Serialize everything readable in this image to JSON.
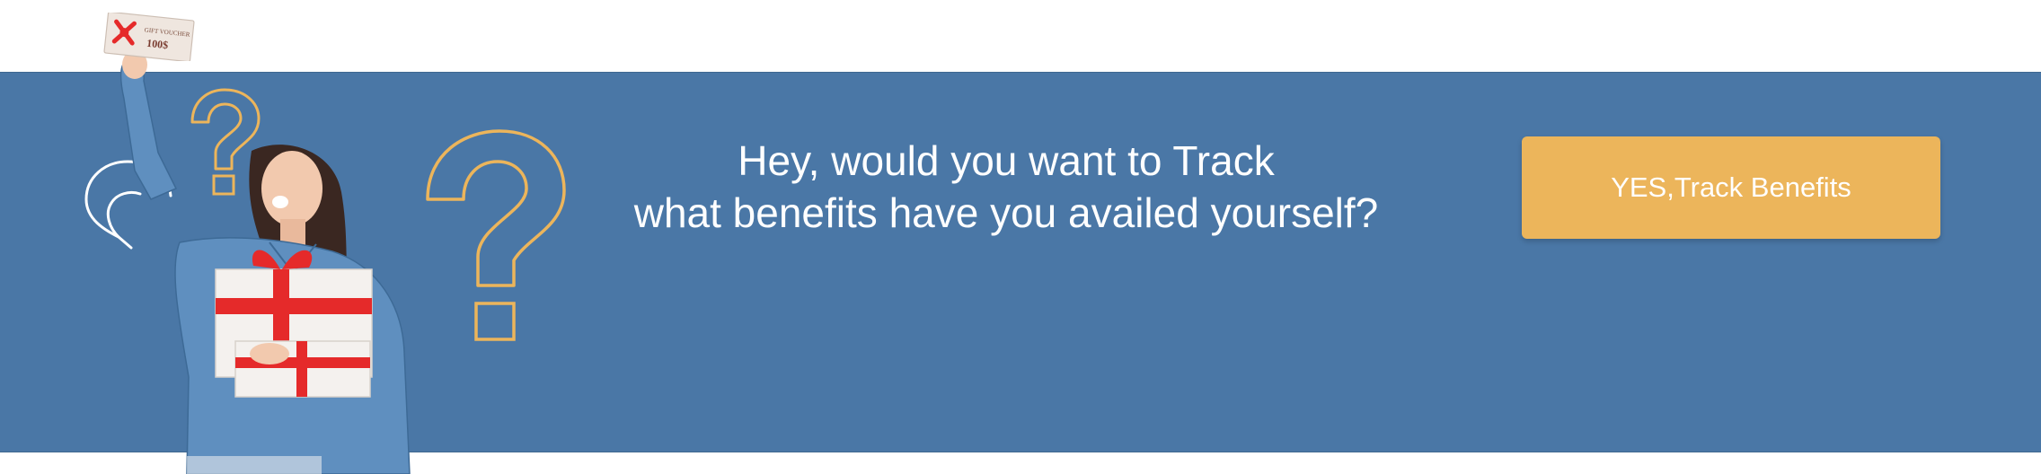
{
  "banner": {
    "headline_line1": "Hey, would you want to Track",
    "headline_line2": "what benefits have you availed yourself?",
    "cta_label": "YES,Track Benefits"
  },
  "voucher": {
    "title": "GIFT VOUCHER",
    "amount": "100$"
  },
  "colors": {
    "banner_bg": "#4a77a6",
    "cta_bg": "#ecb55b",
    "question_mark_stroke": "#ecb55b",
    "text": "#ffffff"
  },
  "icons": [
    "question-mark-icon",
    "gift-box-icon",
    "gift-voucher-icon"
  ]
}
